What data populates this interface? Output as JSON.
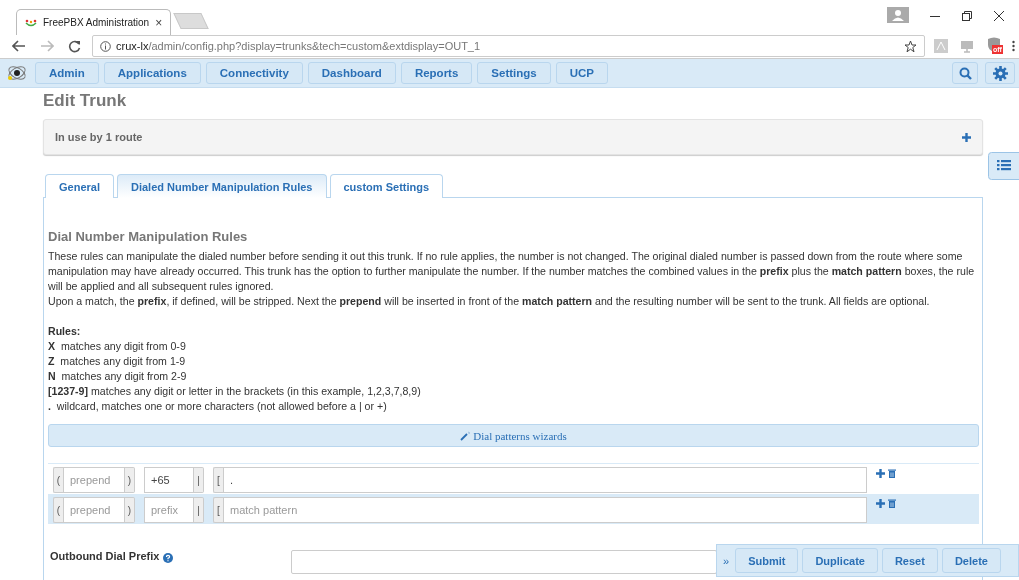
{
  "browser": {
    "tab_title": "FreePBX Administration",
    "tab_close": "×",
    "url_host": "crux-lx",
    "url_path": "/admin/config.php?display=trunks&tech=custom&extdisplay=OUT_1",
    "extension_badge": "off"
  },
  "nav": {
    "menus": [
      {
        "label": "Admin"
      },
      {
        "label": "Applications"
      },
      {
        "label": "Connectivity"
      },
      {
        "label": "Dashboard"
      },
      {
        "label": "Reports"
      },
      {
        "label": "Settings"
      },
      {
        "label": "UCP"
      }
    ]
  },
  "page": {
    "title": "Edit Trunk",
    "usage_panel": {
      "label": "In use by 1 route",
      "expanded": false
    }
  },
  "tabs": [
    {
      "label": "General",
      "selected": false
    },
    {
      "label": "Dialed Number Manipulation Rules",
      "selected": true
    },
    {
      "label": "custom Settings",
      "selected": false
    }
  ],
  "rules_section": {
    "heading": "Dial Number Manipulation Rules",
    "paragraphs": [
      "These rules can manipulate the dialed number before sending it out this trunk. If no rule applies, the number is not changed. The original dialed number is passed down from the route where some manipulation may have already occurred. This trunk has the option to further manipulate the number. If the number matches the combined values in the **prefix** plus the **match pattern** boxes, the rule will be applied and all subsequent rules ignored.",
      "Upon a match, the **prefix**, if defined, will be stripped. Next the **prepend** will be inserted in front of the **match pattern** and the resulting number will be sent to the trunk. All fields are optional."
    ],
    "rules_heading": "Rules:",
    "rules": [
      "**X**  matches any digit from 0-9",
      "**Z**  matches any digit from 1-9",
      "**N**  matches any digit from 2-9",
      "**[1237-9]** matches any digit or letter in the brackets (in this example, 1,2,3,7,8,9)",
      "**.**  wildcard, matches one or more characters (not allowed before a | or +)"
    ],
    "wizard_button": "Dial patterns wizards"
  },
  "patterns": [
    {
      "open_paren": "(",
      "close_paren": ")",
      "pipe": "|",
      "bracket": "[",
      "prepend": {
        "placeholder": "prepend"
      },
      "prefix": {
        "value": "+65"
      },
      "match": {
        "value": "."
      },
      "highlighted": false
    },
    {
      "open_paren": "(",
      "close_paren": ")",
      "pipe": "|",
      "bracket": "[",
      "prepend": {
        "placeholder": "prepend"
      },
      "prefix": {
        "placeholder": "prefix"
      },
      "match": {
        "placeholder": "match pattern"
      },
      "highlighted": true
    }
  ],
  "outbound_dial_prefix": {
    "label": "Outbound Dial Prefix"
  },
  "action_bar": {
    "toggle": "»",
    "buttons": [
      {
        "label": "Submit"
      },
      {
        "label": "Duplicate"
      },
      {
        "label": "Reset"
      },
      {
        "label": "Delete"
      }
    ]
  }
}
